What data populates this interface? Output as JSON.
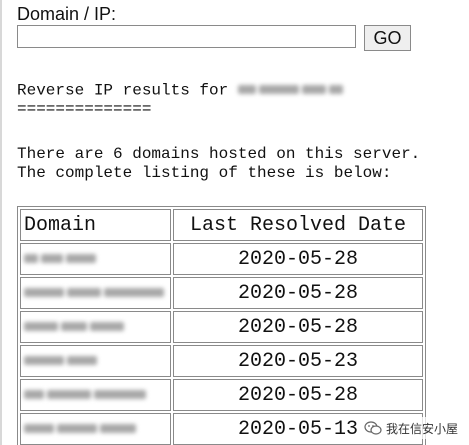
{
  "form": {
    "label": "Domain / IP:",
    "input_value": "",
    "go_label": "GO"
  },
  "results": {
    "heading_prefix": "Reverse IP results for ",
    "underline": "==============",
    "summary_line1": "There are 6 domains hosted on this server.",
    "summary_line2": "The complete listing of these is below:",
    "columns": [
      "Domain",
      "Last Resolved Date"
    ],
    "rows": [
      {
        "date": "2020-05-28"
      },
      {
        "date": "2020-05-28"
      },
      {
        "date": "2020-05-28"
      },
      {
        "date": "2020-05-23"
      },
      {
        "date": "2020-05-28"
      },
      {
        "date": "2020-05-13"
      }
    ]
  },
  "watermark": {
    "text": "我在信安小屋"
  },
  "colors": {
    "border": "#8a8a8a",
    "button_bg": "#efefef",
    "text": "#111111"
  }
}
